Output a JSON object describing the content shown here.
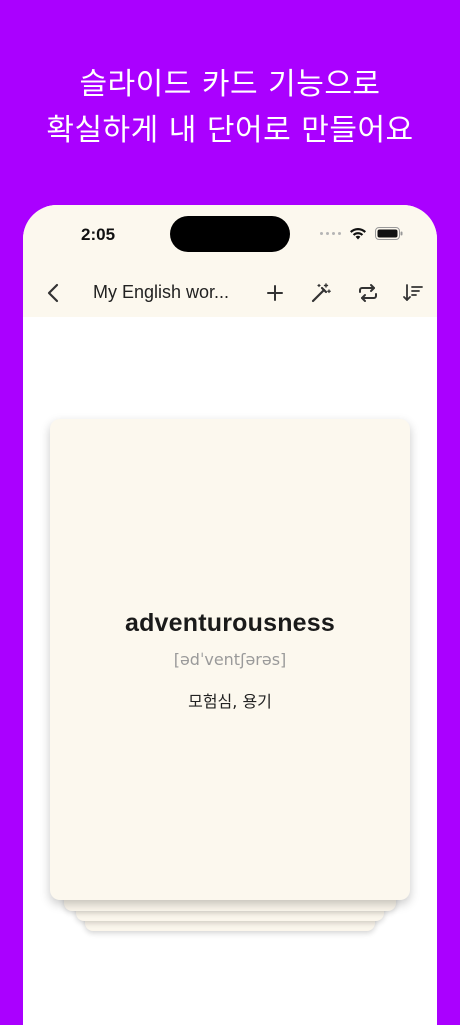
{
  "promo": {
    "line1": "슬라이드 카드 기능으로",
    "line2": "확실하게 내 단어로 만들어요"
  },
  "status_bar": {
    "time": "2:05",
    "icons": [
      "signal-dots-icon",
      "wifi-icon",
      "battery-icon"
    ]
  },
  "nav": {
    "title": "My English wor...",
    "back_icon": "chevron-left-icon",
    "actions": [
      "plus-icon",
      "magic-wand-icon",
      "repeat-icon",
      "sort-icon"
    ]
  },
  "card": {
    "word": "adventurousness",
    "phonetic": "[ədˈventʃərəs]",
    "meaning": "모험심, 용기"
  },
  "colors": {
    "background": "#aa00ff",
    "card": "#fcf8ee",
    "topbar": "#fcf8ee"
  }
}
